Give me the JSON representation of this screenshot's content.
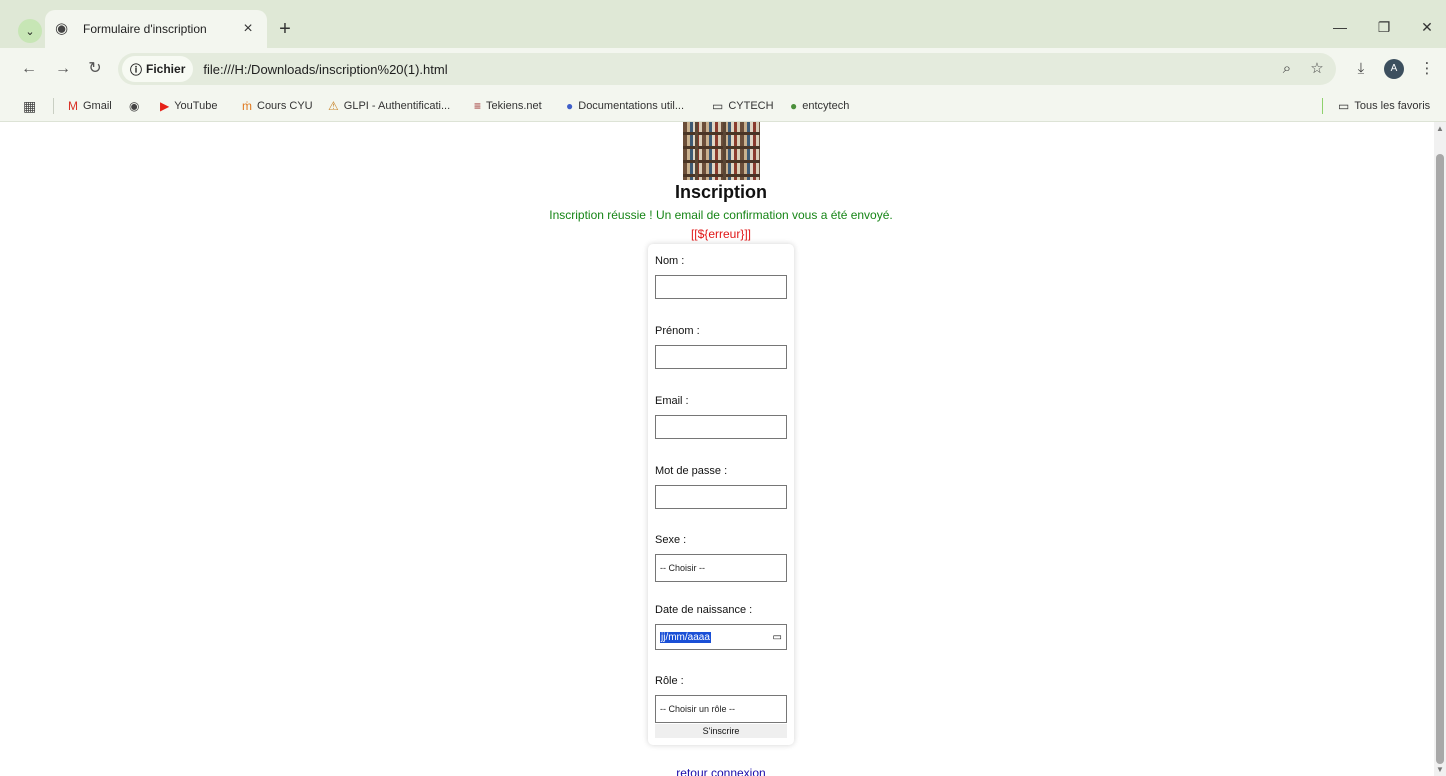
{
  "browser": {
    "tab_title": "Formulaire d'inscription",
    "new_tab_label": "+",
    "chip_label": "Fichier",
    "url": "file:///H:/Downloads/inscription%20(1).html",
    "avatar_letter": "A"
  },
  "bookmarks": [
    {
      "label": "Gmail",
      "icon": "gmail-icon"
    },
    {
      "label": "",
      "icon": "globe-icon"
    },
    {
      "label": "YouTube",
      "icon": "youtube-icon"
    },
    {
      "label": "Cours CYU",
      "icon": "moodle-icon"
    },
    {
      "label": "GLPI - Authentificati...",
      "icon": "glpi-icon"
    },
    {
      "label": "Tekiens.net",
      "icon": "tekiens-icon"
    },
    {
      "label": "Documentations util...",
      "icon": "cy-icon"
    },
    {
      "label": "CYTECH",
      "icon": "folder-icon"
    },
    {
      "label": "entcytech",
      "icon": "ent-icon"
    }
  ],
  "all_bookmarks_label": "Tous les favoris",
  "page": {
    "title": "Inscription",
    "success_message": "Inscription réussie ! Un email de confirmation vous a été envoyé.",
    "error_message": "[[${erreur}]]",
    "fields": {
      "nom": "Nom :",
      "prenom": "Prénom :",
      "email": "Email :",
      "password": "Mot de passe :",
      "sexe": "Sexe :",
      "sexe_selected": "-- Choisir --",
      "birthdate": "Date de naissance :",
      "birthdate_placeholder": "jj/mm/aaaa",
      "role": "Rôle :",
      "role_selected": "-- Choisir un rôle --"
    },
    "submit_label": "S'inscrire",
    "back_link": "retour connexion"
  },
  "colors": {
    "success": "#168516",
    "error": "#e01818",
    "link": "#1a0dab",
    "chrome_bg": "#dfe8d6"
  }
}
